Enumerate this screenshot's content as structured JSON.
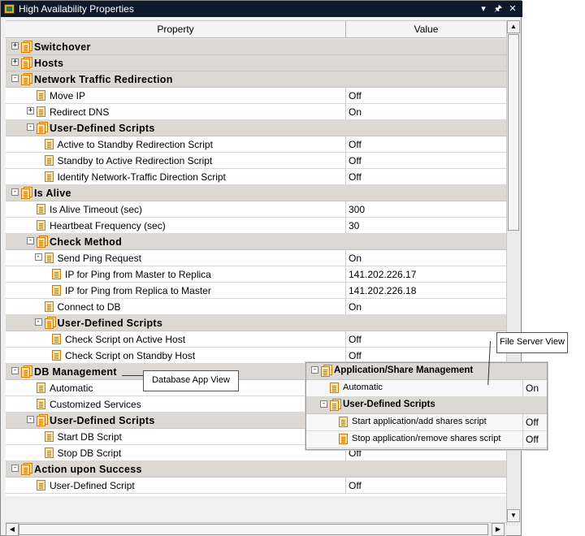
{
  "window": {
    "title": "High Availability Properties",
    "buttons": {
      "dropdown": "▾",
      "pin": "🖈",
      "close": "✕"
    }
  },
  "columns": {
    "property": "Property",
    "value": "Value"
  },
  "rows": [
    {
      "label": "Switchover",
      "value": "",
      "level": 0,
      "cat": true,
      "exp": "+",
      "icon": "multi"
    },
    {
      "label": "Hosts",
      "value": "",
      "level": 0,
      "cat": true,
      "exp": "+",
      "icon": "multi"
    },
    {
      "label": "Network Traffic Redirection",
      "value": "",
      "level": 0,
      "cat": true,
      "exp": "−",
      "icon": "multi"
    },
    {
      "label": "Move IP",
      "value": "Off",
      "level": 2,
      "cat": false,
      "exp": "",
      "icon": "single"
    },
    {
      "label": "Redirect DNS",
      "value": "On",
      "level": 2,
      "cat": false,
      "exp": "+",
      "icon": "single"
    },
    {
      "label": "User-Defined Scripts",
      "value": "",
      "level": 2,
      "cat": true,
      "exp": "−",
      "icon": "multi"
    },
    {
      "label": "Active to Standby Redirection Script",
      "value": "Off",
      "level": 3,
      "cat": false,
      "exp": "",
      "icon": "single"
    },
    {
      "label": "Standby to Active Redirection Script",
      "value": "Off",
      "level": 3,
      "cat": false,
      "exp": "",
      "icon": "single"
    },
    {
      "label": "Identify Network-Traffic Direction Script",
      "value": "Off",
      "level": 3,
      "cat": false,
      "exp": "",
      "icon": "single"
    },
    {
      "label": "Is Alive",
      "value": "",
      "level": 0,
      "cat": true,
      "exp": "−",
      "icon": "multi"
    },
    {
      "label": "Is Alive Timeout (sec)",
      "value": "300",
      "level": 2,
      "cat": false,
      "exp": "",
      "icon": "single"
    },
    {
      "label": "Heartbeat Frequency (sec)",
      "value": "30",
      "level": 2,
      "cat": false,
      "exp": "",
      "icon": "single"
    },
    {
      "label": "Check Method",
      "value": "",
      "level": 2,
      "cat": true,
      "exp": "−",
      "icon": "multi"
    },
    {
      "label": "Send Ping Request",
      "value": "On",
      "level": 3,
      "cat": false,
      "exp": "−",
      "icon": "single"
    },
    {
      "label": "IP for Ping from Master to Replica",
      "value": "141.202.226.17",
      "level": 4,
      "cat": false,
      "exp": "",
      "icon": "single"
    },
    {
      "label": "IP for Ping from Replica to Master",
      "value": "141.202.226.18",
      "level": 4,
      "cat": false,
      "exp": "",
      "icon": "single"
    },
    {
      "label": "Connect to DB",
      "value": "On",
      "level": 3,
      "cat": false,
      "exp": "",
      "icon": "single"
    },
    {
      "label": "User-Defined Scripts",
      "value": "",
      "level": 3,
      "cat": true,
      "exp": "−",
      "icon": "multi"
    },
    {
      "label": "Check Script on Active Host",
      "value": "Off",
      "level": 4,
      "cat": false,
      "exp": "",
      "icon": "single"
    },
    {
      "label": "Check Script on Standby Host",
      "value": "Off",
      "level": 4,
      "cat": false,
      "exp": "",
      "icon": "single"
    },
    {
      "label": "DB Management",
      "value": "",
      "level": 0,
      "cat": true,
      "exp": "−",
      "icon": "multi"
    },
    {
      "label": "Automatic",
      "value": "",
      "level": 2,
      "cat": false,
      "exp": "",
      "icon": "single"
    },
    {
      "label": "Customized Services",
      "value": "",
      "level": 2,
      "cat": false,
      "exp": "",
      "icon": "single"
    },
    {
      "label": "User-Defined Scripts",
      "value": "",
      "level": 2,
      "cat": true,
      "exp": "−",
      "icon": "multi"
    },
    {
      "label": "Start DB Script",
      "value": "",
      "level": 3,
      "cat": false,
      "exp": "",
      "icon": "single"
    },
    {
      "label": "Stop DB Script",
      "value": "Off",
      "level": 3,
      "cat": false,
      "exp": "",
      "icon": "single"
    },
    {
      "label": "Action upon Success",
      "value": "",
      "level": 0,
      "cat": true,
      "exp": "−",
      "icon": "multi"
    },
    {
      "label": "User-Defined Script",
      "value": "Off",
      "level": 2,
      "cat": false,
      "exp": "",
      "icon": "single"
    }
  ],
  "file_server_view": {
    "callout": "File Server View",
    "rows": [
      {
        "label": "Application/Share Management",
        "value": "",
        "level": 0,
        "cat": true,
        "exp": "−",
        "icon": "multi"
      },
      {
        "label": "Automatic",
        "value": "On",
        "level": 1,
        "cat": false,
        "exp": "",
        "icon": "single"
      },
      {
        "label": "User-Defined Scripts",
        "value": "",
        "level": 1,
        "cat": true,
        "exp": "−",
        "icon": "multi"
      },
      {
        "label": "Start application/add shares script",
        "value": "Off",
        "level": 2,
        "cat": false,
        "exp": "",
        "icon": "single"
      },
      {
        "label": "Stop application/remove shares script",
        "value": "Off",
        "level": 2,
        "cat": false,
        "exp": "",
        "icon": "single"
      }
    ]
  },
  "database_app_view": {
    "callout": "Database App View"
  }
}
